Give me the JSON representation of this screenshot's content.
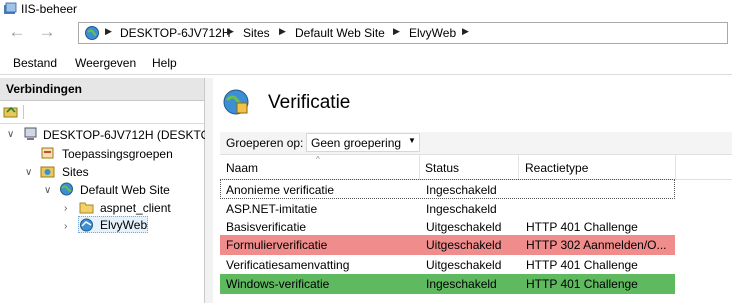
{
  "window": {
    "title": "IIS-beheer"
  },
  "address": {
    "crumbs": [
      "DESKTOP-6JV712H",
      "Sites",
      "Default Web Site",
      "ElvyWeb"
    ]
  },
  "menu": [
    "Bestand",
    "Weergeven",
    "Help"
  ],
  "connections": {
    "header": "Verbindingen",
    "tree": [
      {
        "label": "DESKTOP-6JV712H (DESKTOP-",
        "icon": "server-icon",
        "level": 0,
        "toggle": "expanded"
      },
      {
        "label": "Toepassingsgroepen",
        "icon": "app-pools-icon",
        "level": 1,
        "toggle": "none"
      },
      {
        "label": "Sites",
        "icon": "sites-folder-icon",
        "level": 1,
        "toggle": "expanded"
      },
      {
        "label": "Default Web Site",
        "icon": "globe-icon",
        "level": 2,
        "toggle": "expanded"
      },
      {
        "label": "aspnet_client",
        "icon": "folder-icon",
        "level": 3,
        "toggle": "collapsed"
      },
      {
        "label": "ElvyWeb",
        "icon": "web-app-icon",
        "level": 3,
        "toggle": "collapsed",
        "selected": true
      }
    ]
  },
  "main": {
    "title": "Verificatie",
    "group_label": "Groeperen op:",
    "group_value": "Geen groepering",
    "columns": [
      "Naam",
      "Status",
      "Reactietype"
    ],
    "rows": [
      {
        "name": "Anonieme verificatie",
        "status": "Ingeschakeld",
        "type": "",
        "highlight": "focus"
      },
      {
        "name": "ASP.NET-imitatie",
        "status": "Ingeschakeld",
        "type": "",
        "highlight": "none"
      },
      {
        "name": "Basisverificatie",
        "status": "Uitgeschakeld",
        "type": "HTTP 401 Challenge",
        "highlight": "none"
      },
      {
        "name": "Formulierverificatie",
        "status": "Uitgeschakeld",
        "type": "HTTP 302 Aanmelden/O...",
        "highlight": "red"
      },
      {
        "name": "Verificatiesamenvatting",
        "status": "Uitgeschakeld",
        "type": "HTTP 401 Challenge",
        "highlight": "none"
      },
      {
        "name": "Windows-verificatie",
        "status": "Ingeschakeld",
        "type": "HTTP 401 Challenge",
        "highlight": "green"
      }
    ]
  },
  "colors": {
    "row_red": "#f08c8c",
    "row_green": "#5fb95f",
    "accent_selection": "#e5f1fb"
  }
}
